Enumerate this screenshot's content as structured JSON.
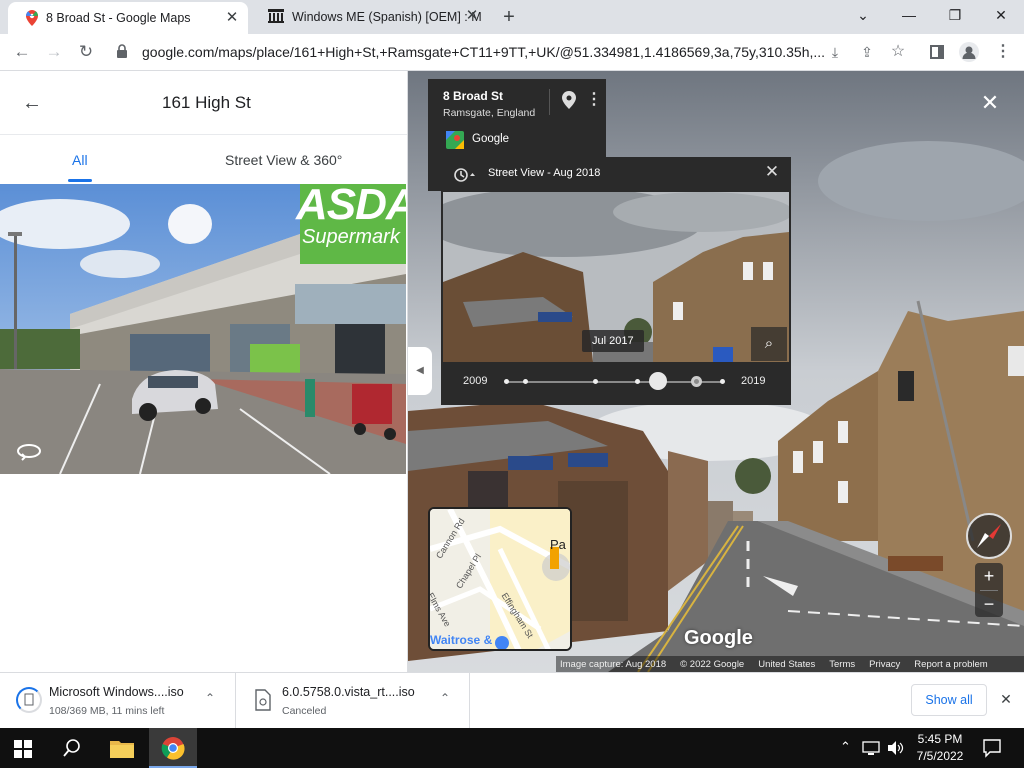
{
  "tabs": [
    {
      "title": "8 Broad St - Google Maps",
      "active": true
    },
    {
      "title": "Windows ME (Spanish) [OEM] : M",
      "active": false
    }
  ],
  "window_controls": {
    "minimize": "—",
    "restore": "❐",
    "close": "✕",
    "dropdown": "⌄",
    "new_tab": "+"
  },
  "address_bar": {
    "url": "google.com/maps/place/161+High+St,+Ramsgate+CT11+9TT,+UK/@51.334981,1.4186569,3a,75y,310.35h,..."
  },
  "left_panel": {
    "title": "161 High St",
    "filter_tabs": [
      {
        "label": "All",
        "selected": true
      },
      {
        "label": "Street View & 360°",
        "selected": false
      }
    ],
    "photo_sign_text": "ASDA",
    "photo_sign_sub": "Supermark"
  },
  "info_card": {
    "place_name": "8 Broad St",
    "place_region": "Ramsgate, England",
    "provider": "Google"
  },
  "time_machine": {
    "title": "Street View - Aug 2018",
    "preview_date": "Jul 2017",
    "start_year": "2009",
    "end_year": "2019",
    "slider_fraction": 0.7
  },
  "minimap": {
    "streets": [
      "Cannon Rd",
      "Chapel Pl",
      "Elms Ave",
      "Effingham St"
    ],
    "place_label": "Waitrose &",
    "edge_label": "Pa"
  },
  "street_view": {
    "watermark": "Google",
    "footer": [
      "Image capture: Aug 2018",
      "© 2022 Google",
      "United States",
      "Terms",
      "Privacy",
      "Report a problem"
    ],
    "zoom_in": "+",
    "zoom_out": "−"
  },
  "downloads": [
    {
      "name": "Microsoft Windows....iso",
      "status": "108/369 MB, 11 mins left"
    },
    {
      "name": "6.0.5758.0.vista_rt....iso",
      "status": "Canceled"
    }
  ],
  "show_all_label": "Show all",
  "taskbar": {
    "time": "5:45 PM",
    "date": "7/5/2022"
  },
  "colors": {
    "accent": "#1a73e8",
    "asda_green": "#5fb846",
    "panel_dark": "#2a2a2a"
  }
}
